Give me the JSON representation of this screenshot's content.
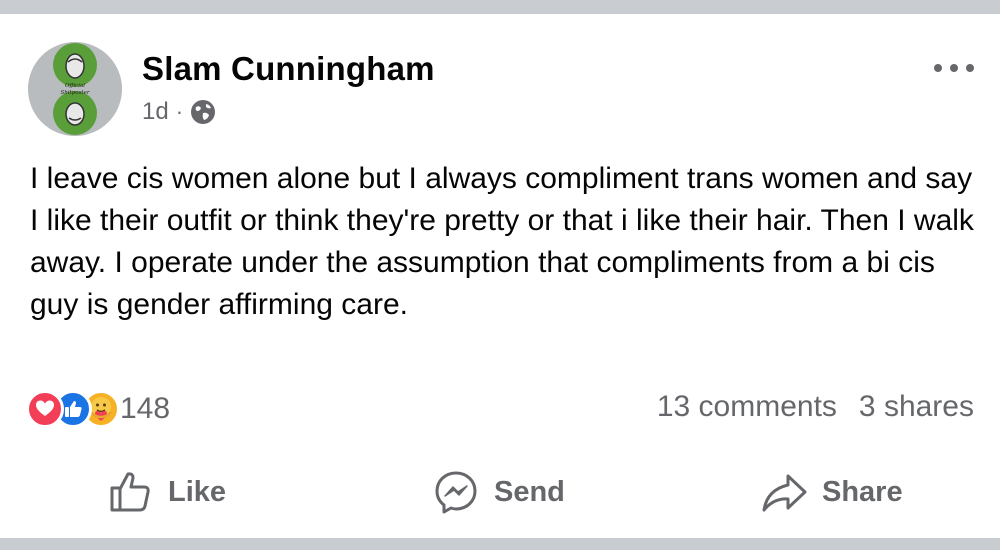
{
  "post": {
    "author": "Slam Cunningham",
    "time": "1d",
    "separator": "·",
    "audience_icon": "globe-icon",
    "body": "I leave cis women alone but I always compliment trans women and say I like their outfit or think they're pretty or that i like their hair. Then I walk away. I operate under the assumption that compliments from a bi cis guy is gender affirming care.",
    "avatar_text_top": "Official",
    "avatar_text_bottom": "Shitposter"
  },
  "reactions": {
    "icons": [
      "love-icon",
      "like-icon",
      "care-icon"
    ],
    "count": "148"
  },
  "stats": {
    "comments": "13 comments",
    "shares": "3 shares"
  },
  "actions": {
    "like": "Like",
    "send": "Send",
    "share": "Share"
  },
  "colors": {
    "divider": "#c9ccd1",
    "secondary_text": "#65676b",
    "love": "#f33e58",
    "like": "#1b74e4",
    "care": "#f7b125",
    "avatar_green": "#5a9e3a"
  }
}
